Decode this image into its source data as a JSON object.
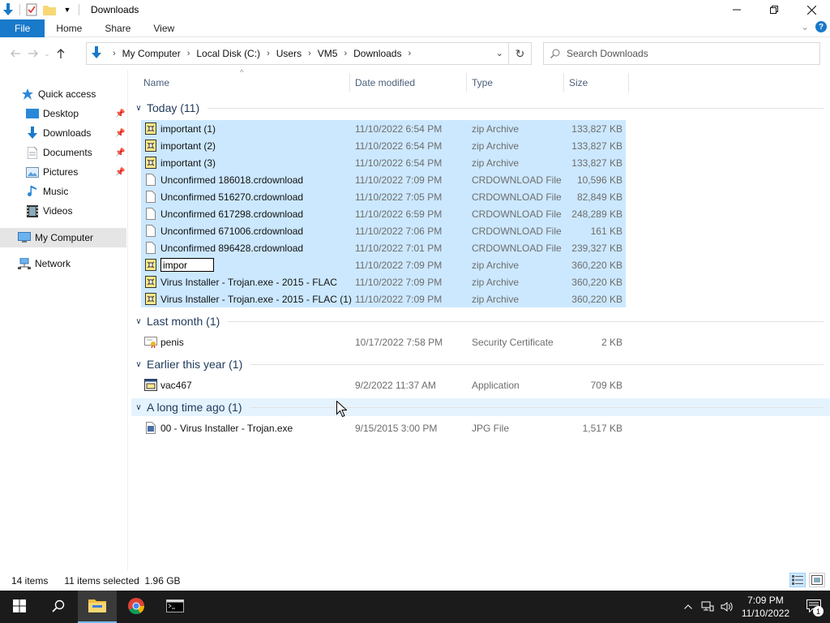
{
  "window": {
    "title": "Downloads",
    "controls": [
      "minimize",
      "maximize",
      "close"
    ]
  },
  "ribbon": {
    "tabs": [
      {
        "label": "File"
      },
      {
        "label": "Home"
      },
      {
        "label": "Share"
      },
      {
        "label": "View"
      }
    ]
  },
  "address": {
    "crumbs": [
      "My Computer",
      "Local Disk (C:)",
      "Users",
      "VM5",
      "Downloads"
    ]
  },
  "search": {
    "placeholder": "Search Downloads"
  },
  "nav": {
    "quick_access": "Quick access",
    "items": [
      {
        "label": "Desktop",
        "icon": "desktop-icon",
        "pinned": true
      },
      {
        "label": "Downloads",
        "icon": "downloads-icon",
        "pinned": true
      },
      {
        "label": "Documents",
        "icon": "documents-icon",
        "pinned": true
      },
      {
        "label": "Pictures",
        "icon": "pictures-icon",
        "pinned": true
      },
      {
        "label": "Music",
        "icon": "music-icon",
        "pinned": false
      },
      {
        "label": "Videos",
        "icon": "videos-icon",
        "pinned": false
      }
    ],
    "my_computer": "My Computer",
    "network": "Network"
  },
  "columns": {
    "name": "Name",
    "date": "Date modified",
    "type": "Type",
    "size": "Size"
  },
  "groups": [
    {
      "label": "Today (11)",
      "files": [
        {
          "name": "important (1)",
          "date": "11/10/2022 6:54 PM",
          "type": "zip Archive",
          "size": "133,827 KB",
          "icon": "zip-icon",
          "selected": true
        },
        {
          "name": "important (2)",
          "date": "11/10/2022 6:54 PM",
          "type": "zip Archive",
          "size": "133,827 KB",
          "icon": "zip-icon",
          "selected": true
        },
        {
          "name": "important (3)",
          "date": "11/10/2022 6:54 PM",
          "type": "zip Archive",
          "size": "133,827 KB",
          "icon": "zip-icon",
          "selected": true
        },
        {
          "name": "Unconfirmed 186018.crdownload",
          "date": "11/10/2022 7:09 PM",
          "type": "CRDOWNLOAD File",
          "size": "10,596 KB",
          "icon": "file-icon",
          "selected": true
        },
        {
          "name": "Unconfirmed 516270.crdownload",
          "date": "11/10/2022 7:05 PM",
          "type": "CRDOWNLOAD File",
          "size": "82,849 KB",
          "icon": "file-icon",
          "selected": true
        },
        {
          "name": "Unconfirmed 617298.crdownload",
          "date": "11/10/2022 6:59 PM",
          "type": "CRDOWNLOAD File",
          "size": "248,289 KB",
          "icon": "file-icon",
          "selected": true
        },
        {
          "name": "Unconfirmed 671006.crdownload",
          "date": "11/10/2022 7:06 PM",
          "type": "CRDOWNLOAD File",
          "size": "161 KB",
          "icon": "file-icon",
          "selected": true
        },
        {
          "name": "Unconfirmed 896428.crdownload",
          "date": "11/10/2022 7:01 PM",
          "type": "CRDOWNLOAD File",
          "size": "239,327 KB",
          "icon": "file-icon",
          "selected": true
        },
        {
          "name": "impor",
          "date": "11/10/2022 7:09 PM",
          "type": "zip Archive",
          "size": "360,220 KB",
          "icon": "zip-icon",
          "selected": true,
          "renaming": true
        },
        {
          "name": "Virus Installer - Trojan.exe - 2015 - FLAC",
          "date": "11/10/2022 7:09 PM",
          "type": "zip Archive",
          "size": "360,220 KB",
          "icon": "zip-icon",
          "selected": true
        },
        {
          "name": "Virus Installer - Trojan.exe - 2015 - FLAC (1)",
          "date": "11/10/2022 7:09 PM",
          "type": "zip Archive",
          "size": "360,220 KB",
          "icon": "zip-icon",
          "selected": true
        }
      ]
    },
    {
      "label": "Last month (1)",
      "files": [
        {
          "name": "penis",
          "date": "10/17/2022 7:58 PM",
          "type": "Security Certificate",
          "size": "2 KB",
          "icon": "certificate-icon",
          "selected": false
        }
      ]
    },
    {
      "label": "Earlier this year (1)",
      "files": [
        {
          "name": "vac467",
          "date": "9/2/2022 11:37 AM",
          "type": "Application",
          "size": "709 KB",
          "icon": "application-icon",
          "selected": false
        }
      ]
    },
    {
      "label": "A long time ago (1)",
      "hover": true,
      "files": [
        {
          "name": "00 - Virus Installer - Trojan.exe",
          "date": "9/15/2015 3:00 PM",
          "type": "JPG File",
          "size": "1,517 KB",
          "icon": "image-file-icon",
          "selected": false
        }
      ]
    }
  ],
  "status": {
    "count": "14 items",
    "selection": "11 items selected  1.96 GB"
  },
  "taskbar": {
    "time": "7:09 PM",
    "date": "11/10/2022",
    "notification_count": "1"
  },
  "colors": {
    "accent": "#1979ca",
    "selection": "#cce8ff",
    "group_text": "#1e395b",
    "taskbar": "#1b1b1b"
  }
}
